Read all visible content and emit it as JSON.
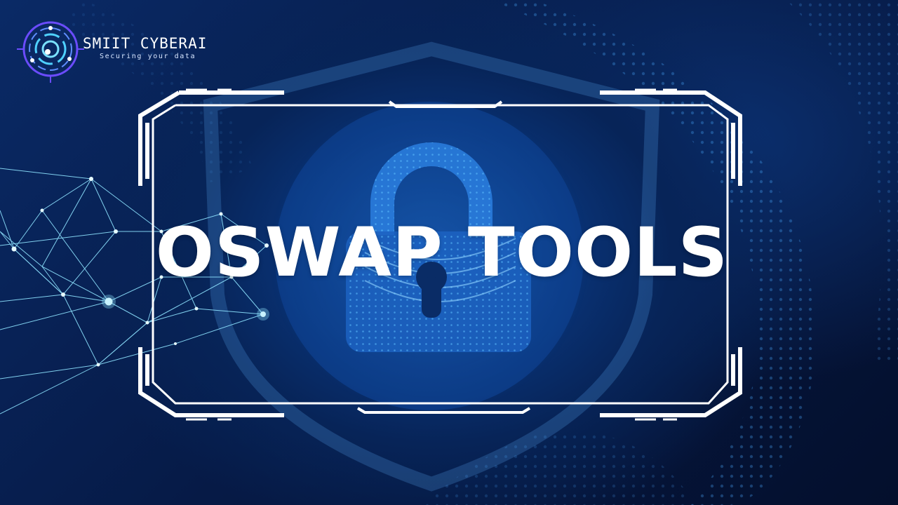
{
  "brand": {
    "name": "SMIIT CYBERAI",
    "tagline": "Securing your data"
  },
  "title": "OSWAP TOOLS",
  "colors": {
    "background": "#06163a",
    "accent": "#1f8fff",
    "frame": "#ffffff",
    "text": "#ffffff"
  },
  "icons": [
    "logo-icon",
    "padlock-icon",
    "shield-icon",
    "network-mesh",
    "title-frame"
  ]
}
